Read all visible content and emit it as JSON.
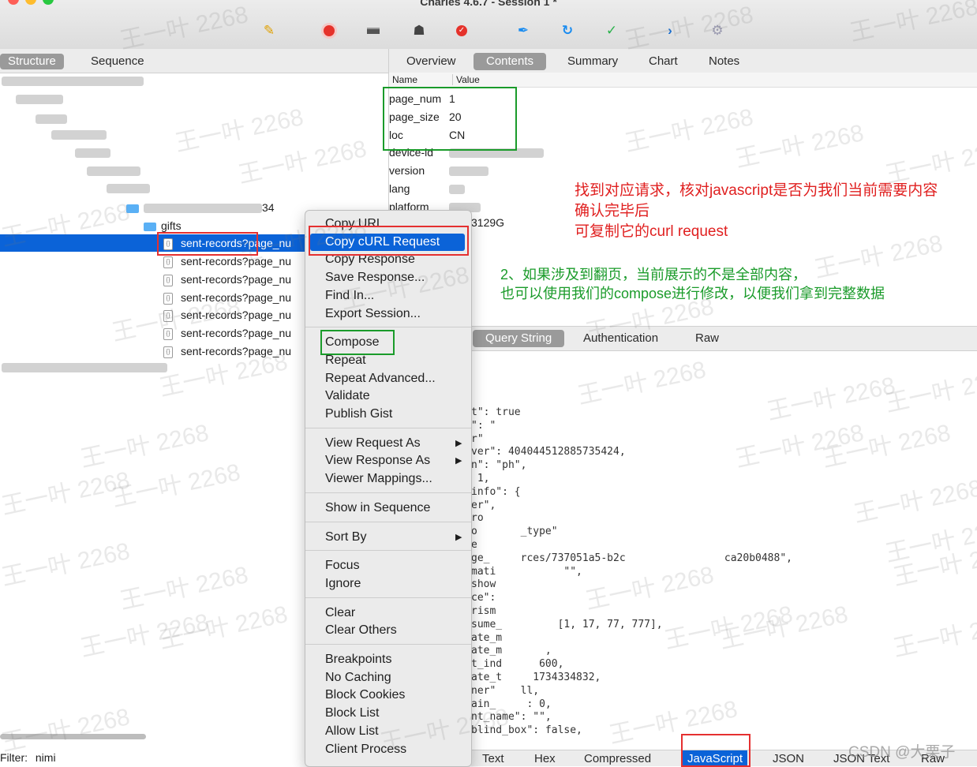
{
  "window": {
    "title": "Charles 4.6.7 - Session 1 *"
  },
  "toolbar": {
    "icons": [
      "broom-icon",
      "record-icon",
      "throttle-icon",
      "turtle-icon",
      "breakpoint-icon",
      "pen-icon",
      "refresh-icon",
      "check-icon",
      "chevron-right-icon",
      "gear-icon"
    ],
    "colors": {
      "red": "#e5322b",
      "blue": "#1a8cf0",
      "green": "#2bb24c"
    }
  },
  "left_tabs": [
    "Structure",
    "Sequence"
  ],
  "tree": {
    "folder_partial": "34",
    "gifts": "gifts",
    "requests": [
      "sent-records?page_nu",
      "sent-records?page_nu",
      "sent-records?page_nu",
      "sent-records?page_nu",
      "sent-records?page_nu",
      "sent-records?page_nu",
      "sent-records?page_nu"
    ]
  },
  "right_tabs": [
    "Overview",
    "Contents",
    "Summary",
    "Chart",
    "Notes"
  ],
  "kv": {
    "header": {
      "name": "Name",
      "value": "Value"
    },
    "rows": [
      {
        "k": "page_num",
        "v": "1"
      },
      {
        "k": "page_size",
        "v": "20"
      },
      {
        "k": "loc",
        "v": "CN"
      },
      {
        "k": "device-id",
        "v": ""
      },
      {
        "k": "version",
        "v": ""
      },
      {
        "k": "lang",
        "v": ""
      },
      {
        "k": "platform",
        "v": ""
      }
    ],
    "partial_value": "3129G"
  },
  "menu": {
    "groups": [
      [
        "Copy URL",
        "Copy cURL Request",
        "Copy Response",
        "Save Response...",
        "Find In...",
        "Export Session..."
      ],
      [
        "Compose",
        "Repeat",
        "Repeat Advanced...",
        "Validate",
        "Publish Gist"
      ],
      [
        "View Request As",
        "View Response As",
        "Viewer Mappings..."
      ],
      [
        "Show in Sequence"
      ],
      [
        "Sort By"
      ],
      [
        "Focus",
        "Ignore"
      ],
      [
        "Clear",
        "Clear Others"
      ],
      [
        "Breakpoints",
        "No Caching",
        "Block Cookies",
        "Block List",
        "Allow List",
        "Client Process"
      ]
    ],
    "submenu_arrow": "▶"
  },
  "annotations": {
    "red": [
      "找到对应请求，核对javascript是否为我们当前需要内容",
      "确认完毕后",
      "可复制它的curl request"
    ],
    "green": [
      "2、如果涉及到翻页，当前展示的不是全部内容，",
      "也可以使用我们的compose进行修改，以便我们拿到完整数据"
    ]
  },
  "lower_tabs": [
    "Query String",
    "Authentication",
    "Raw"
  ],
  "code_lines": [
    "t\": true",
    "\": \"",
    "r\"",
    "ver\": 404044512885735424,",
    "n\": \"ph\",",
    " 1,",
    "info\": {",
    "er\",",
    "ro",
    "o       _type\"",
    "e",
    "ge_     rces/737051a5-b2c                ca20b0488\",",
    "mati           \"\",",
    "show",
    "ce\":",
    "rism",
    "sume_         [1, 17, 77, 777],",
    "ate_m",
    "ate_m       ,",
    "t_ind      600,",
    "ate_t     1734334832,",
    "ner\"    ll,",
    "ain_     : 0,",
    "nt_name\": \"\",",
    "blind_box\": false,"
  ],
  "bottom_tabs": [
    "Text",
    "Hex",
    "Compressed",
    "JavaScript",
    "JSON",
    "JSON Text",
    "Raw"
  ],
  "filter": {
    "label": "Filter:",
    "value": "nimi"
  },
  "watermark": {
    "text": "王一叶 2268",
    "csdn": "CSDN @大栗子"
  }
}
